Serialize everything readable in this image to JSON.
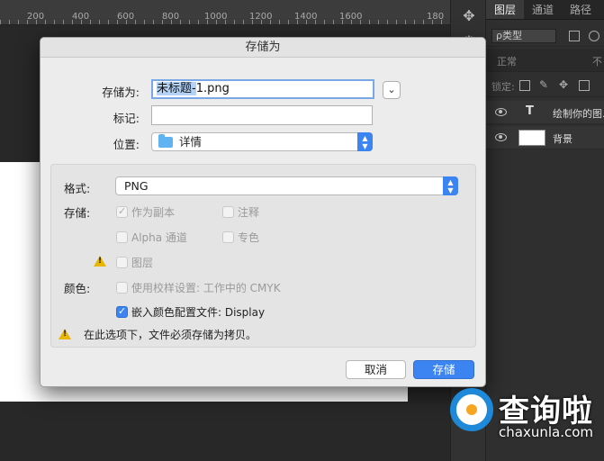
{
  "ruler": {
    "numbers": [
      "200",
      "400",
      "600",
      "800",
      "1000",
      "1200",
      "1400",
      "1600",
      "180"
    ]
  },
  "layers_panel": {
    "tabs": [
      "图层",
      "通道",
      "路径"
    ],
    "kind_filter": "ρ类型",
    "blend_mode": "正常",
    "opacity_label": "不",
    "lock_label": "锁定:",
    "layers": [
      {
        "type_icon": "T",
        "name": "绘制你的图..."
      },
      {
        "type_icon": "",
        "name": "背景"
      }
    ]
  },
  "dialog": {
    "title": "存储为",
    "save_as_label": "存储为:",
    "filename_selected": "未标题-",
    "filename_rest": "1.png",
    "tags_label": "标记:",
    "tags_value": "",
    "location_label": "位置:",
    "location_value": "详情",
    "format_label": "格式:",
    "format_value": "PNG",
    "save_label": "存储:",
    "options": {
      "as_copy": "作为副本",
      "notes": "注释",
      "alpha": "Alpha 通道",
      "spot": "专色",
      "layers": "图层",
      "color_label": "颜色:",
      "proof": "使用校样设置: 工作中的 CMYK",
      "embed": "嵌入颜色配置文件: Display"
    },
    "warning": "在此选项下，文件必须存储为拷贝。",
    "cancel_button": "取消",
    "save_button": "存储"
  },
  "watermark": {
    "chinese": "查询啦",
    "domain": "chaxunla.com"
  },
  "colors": {
    "accent": "#3b84f2",
    "dialog_bg": "#ececec",
    "ps_dark": "#2f2f2f",
    "warning": "#e8b500"
  }
}
